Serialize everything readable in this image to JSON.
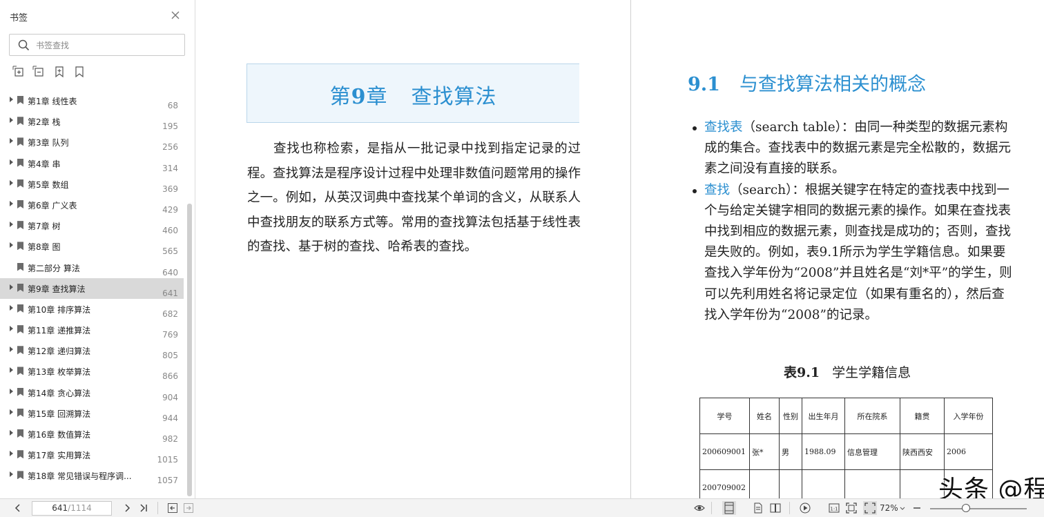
{
  "sidebar": {
    "title": "书签",
    "search_placeholder": "书签查找",
    "bookmarks": [
      {
        "label": "第1章 线性表",
        "page": "68",
        "has_children": true,
        "selected": false
      },
      {
        "label": "第2章 栈",
        "page": "195",
        "has_children": true,
        "selected": false
      },
      {
        "label": "第3章 队列",
        "page": "256",
        "has_children": true,
        "selected": false
      },
      {
        "label": "第4章 串",
        "page": "314",
        "has_children": true,
        "selected": false
      },
      {
        "label": "第5章 数组",
        "page": "369",
        "has_children": true,
        "selected": false
      },
      {
        "label": "第6章 广义表",
        "page": "429",
        "has_children": true,
        "selected": false
      },
      {
        "label": "第7章 树",
        "page": "460",
        "has_children": true,
        "selected": false
      },
      {
        "label": "第8章 图",
        "page": "565",
        "has_children": true,
        "selected": false
      },
      {
        "label": "第二部分 算法",
        "page": "640",
        "has_children": false,
        "selected": false
      },
      {
        "label": "第9章 查找算法",
        "page": "641",
        "has_children": true,
        "selected": true
      },
      {
        "label": "第10章 排序算法",
        "page": "682",
        "has_children": true,
        "selected": false
      },
      {
        "label": "第11章 递推算法",
        "page": "769",
        "has_children": true,
        "selected": false
      },
      {
        "label": "第12章 递归算法",
        "page": "805",
        "has_children": true,
        "selected": false
      },
      {
        "label": "第13章 枚举算法",
        "page": "866",
        "has_children": true,
        "selected": false
      },
      {
        "label": "第14章 贪心算法",
        "page": "904",
        "has_children": true,
        "selected": false
      },
      {
        "label": "第15章 回溯算法",
        "page": "944",
        "has_children": true,
        "selected": false
      },
      {
        "label": "第16章 数值算法",
        "page": "982",
        "has_children": true,
        "selected": false
      },
      {
        "label": "第17章 实用算法",
        "page": "1015",
        "has_children": true,
        "selected": false
      },
      {
        "label": "第18章 常见错误与程序调...",
        "page": "1057",
        "has_children": true,
        "selected": false
      }
    ]
  },
  "left_page": {
    "chapter_prefix": "第",
    "chapter_num": "9",
    "chapter_suffix": "章",
    "chapter_name": "查找算法",
    "intro": "查找也称检索，是指从一批记录中找到指定记录的过程。查找算法是程序设计过程中处理非数值问题常用的操作之一。例如，从英汉词典中查找某个单词的含义，从联系人中查找朋友的联系方式等。常用的查找算法包括基于线性表的查找、基于树的查找、哈希表的查找。"
  },
  "right_page": {
    "section_num": "9.1",
    "section_title": "与查找算法相关的概念",
    "bullets": [
      {
        "term": "查找表",
        "rest": "（search table）：由同一种类型的数据元素构成的集合。查找表中的数据元素是完全松散的，数据元素之间没有直接的联系。"
      },
      {
        "term": "查找",
        "rest": "（search）：根据关键字在特定的查找表中找到一个与给定关键字相同的数据元素的操作。如果在查找表中找到相应的数据元素，则查找是成功的；否则，查找是失败的。例如，表9.1所示为学生学籍信息。如果要查找入学年份为“2008”并且姓名是“刘*平”的学生，则可以先利用姓名将记录定位（如果有重名的），然后查找入学年份为“2008”的记录。"
      }
    ],
    "table_caption_num": "表9.1",
    "table_caption_title": "学生学籍信息",
    "table_headers": [
      "学号",
      "姓名",
      "性别",
      "出生年月",
      "所在院系",
      "籍贯",
      "入学年份"
    ],
    "table_rows": [
      [
        "200609001",
        "张*",
        "男",
        "1988.09",
        "信息管理",
        "陕西西安",
        "2006"
      ],
      [
        "200709002",
        "",
        "",
        "",
        "",
        "",
        ""
      ]
    ]
  },
  "watermark": "头条 @程序员高级码农II",
  "statusbar": {
    "current_page": "641",
    "total_pages": "/1114",
    "zoom": "72%",
    "zoom_level_percent": 72
  },
  "colors": {
    "accent_blue": "#2b8fd0",
    "selected_row": "#d9d9d9",
    "chapter_box_bg": "#eef6fc"
  }
}
